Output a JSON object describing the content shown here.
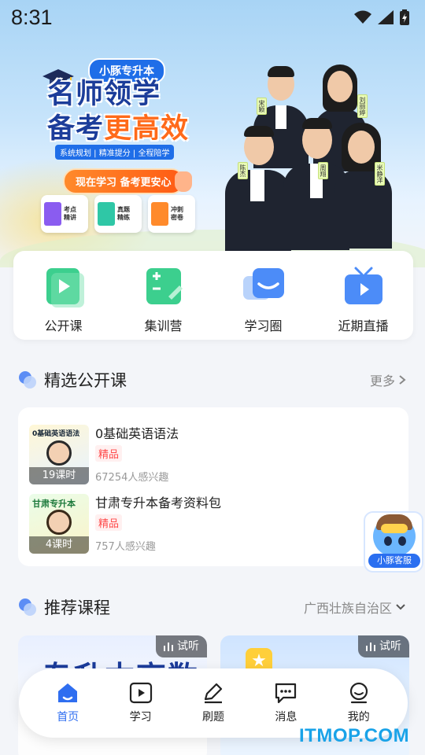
{
  "status_bar": {
    "time": "8:31"
  },
  "banner": {
    "brand": "小豚专升本",
    "headline_line1": "名师领学",
    "headline_line2_prefix": "备考",
    "headline_line2_highlight": "更高效",
    "tagline": "系统规划 | 精准提分 | 全程陪学",
    "cta": "现在学习  备考更安心",
    "books": [
      {
        "label": "考点精讲",
        "color": "#8a5cf0"
      },
      {
        "label": "真题精练",
        "color": "#2fc7a6"
      },
      {
        "label": "冲刺密卷",
        "color": "#ff8a2b"
      }
    ],
    "teacher_names": [
      "宋颖",
      "刘丽婷",
      "陈杰",
      "周翔",
      "米静洋"
    ]
  },
  "quick_actions": [
    {
      "label": "公开课",
      "icon": "play-icon",
      "color": "#3ccf8e"
    },
    {
      "label": "集训营",
      "icon": "calculator-icon",
      "color": "#3ccf8e"
    },
    {
      "label": "学习圈",
      "icon": "chat-smile-icon",
      "color": "#4c8cf8"
    },
    {
      "label": "近期直播",
      "icon": "tv-play-icon",
      "color": "#4c8cf8"
    }
  ],
  "featured": {
    "title": "精选公开课",
    "more": "更多",
    "courses": [
      {
        "title": "0基础英语语法",
        "tag": "精品",
        "interest": "67254人感兴趣",
        "lessons": "19课时",
        "thumb_text": "0基础英语语法"
      },
      {
        "title": "甘肃专升本备考资料包",
        "tag": "精品",
        "interest": "757人感兴趣",
        "lessons": "4课时",
        "thumb_text": "甘肃专升本"
      }
    ]
  },
  "service": {
    "label": "小豚客服"
  },
  "recommended": {
    "title": "推荐课程",
    "region": "广西壮族自治区",
    "cards": [
      {
        "trial": "试听",
        "text": "专升本高数"
      },
      {
        "trial": "试听"
      }
    ]
  },
  "bottom_nav": [
    {
      "label": "首页",
      "icon": "home-icon",
      "active": true
    },
    {
      "label": "学习",
      "icon": "play-square-icon",
      "active": false
    },
    {
      "label": "刷题",
      "icon": "pen-icon",
      "active": false
    },
    {
      "label": "消息",
      "icon": "message-icon",
      "active": false
    },
    {
      "label": "我的",
      "icon": "smile-user-icon",
      "active": false
    }
  ],
  "watermark": "ITMOP.COM",
  "colors": {
    "accent": "#2f6ef0",
    "green": "#3ccf8e",
    "blue": "#4c8cf8",
    "tag_red": "#ff4a4a"
  }
}
